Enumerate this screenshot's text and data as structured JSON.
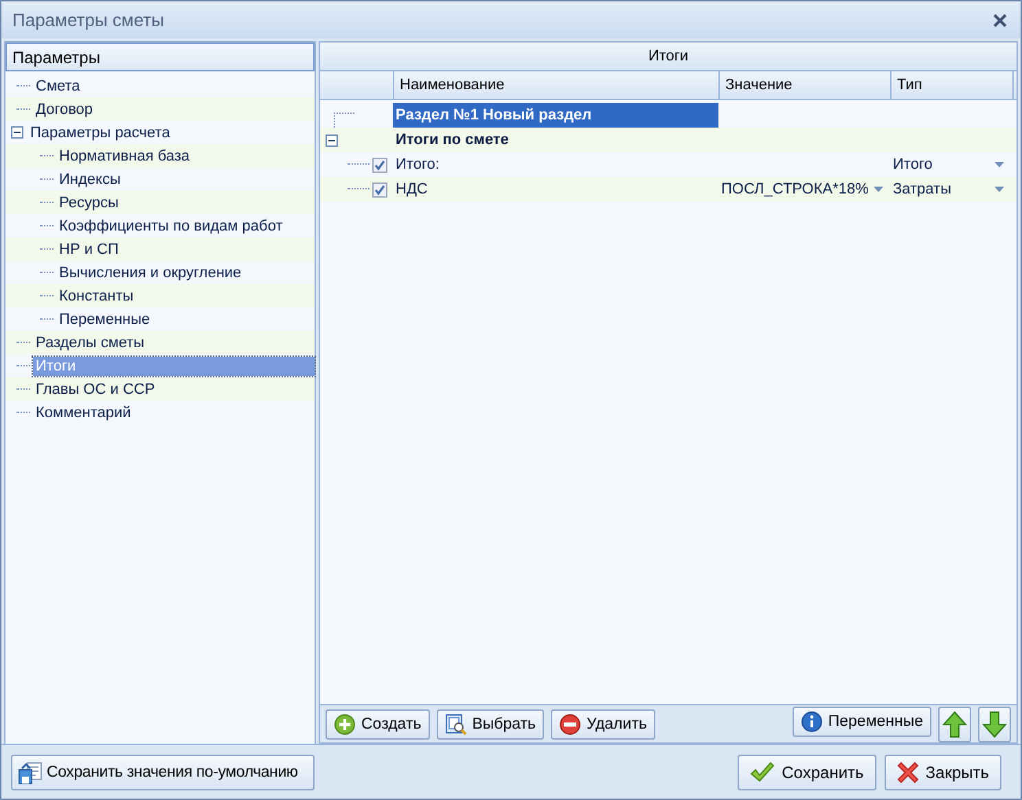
{
  "window": {
    "title": "Параметры сметы"
  },
  "sidebar": {
    "header": "Параметры",
    "items": [
      {
        "label": "Смета",
        "selected": false
      },
      {
        "label": "Договор",
        "selected": false
      },
      {
        "label": "Параметры расчета",
        "selected": false,
        "expanded": true,
        "children": [
          {
            "label": "Нормативная база",
            "selected": false
          },
          {
            "label": "Индексы",
            "selected": false
          },
          {
            "label": "Ресурсы",
            "selected": false
          },
          {
            "label": "Коэффициенты по видам работ",
            "selected": false
          },
          {
            "label": "НР и СП",
            "selected": false
          },
          {
            "label": "Вычисления и округление",
            "selected": false
          },
          {
            "label": "Константы",
            "selected": false
          },
          {
            "label": "Переменные",
            "selected": false
          }
        ]
      },
      {
        "label": "Разделы сметы",
        "selected": false
      },
      {
        "label": "Итоги",
        "selected": true
      },
      {
        "label": "Главы ОС и ССР",
        "selected": false
      },
      {
        "label": "Комментарий",
        "selected": false
      }
    ]
  },
  "grid": {
    "title": "Итоги",
    "columns": [
      "Наименование",
      "Значение",
      "Тип"
    ],
    "rows": [
      {
        "kind": "section",
        "name": "Раздел №1 Новый раздел",
        "selected": true
      },
      {
        "kind": "group",
        "name": "Итоги по смете",
        "selected": false,
        "expanded": true,
        "children": [
          {
            "kind": "item",
            "name": "Итого:",
            "checked": true,
            "type": "Итого",
            "selected": false
          },
          {
            "kind": "item",
            "name": "НДС",
            "checked": true,
            "value": "ПОСЛ_СТРОКА*18%",
            "type": "Затраты",
            "selected": false
          }
        ]
      }
    ]
  },
  "toolbar": {
    "left": [
      {
        "kind": "create",
        "label": "Создать"
      },
      {
        "kind": "select",
        "label": "Выбрать"
      },
      {
        "kind": "delete",
        "label": "Удалить"
      }
    ],
    "right": [
      {
        "kind": "info",
        "label": "Переменные"
      },
      {
        "kind": "up"
      },
      {
        "kind": "down"
      }
    ]
  },
  "footer": {
    "left": [
      {
        "kind": "save-default",
        "label": "Сохранить значения по-умолчанию"
      }
    ],
    "right": [
      {
        "kind": "ok",
        "label": "Сохранить"
      },
      {
        "kind": "close",
        "label": "Закрыть"
      }
    ]
  }
}
